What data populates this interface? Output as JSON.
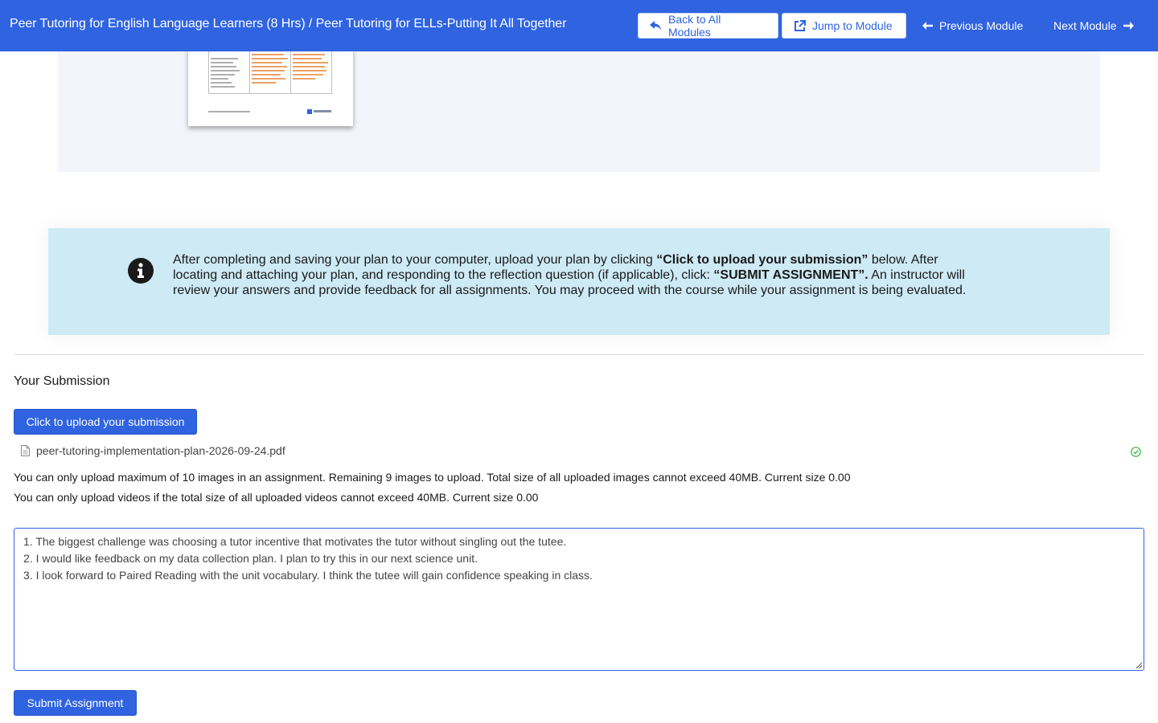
{
  "header": {
    "breadcrumb": "Peer Tutoring for English Language Learners (8 Hrs) / Peer Tutoring for ELLs-Putting It All Together",
    "back_label": "Back to All Modules",
    "jump_label": "Jump to Module",
    "prev_label": "Previous Module",
    "next_label": "Next Module"
  },
  "info": {
    "part1": "After completing and saving your plan to your computer, upload your plan by clicking ",
    "bold1": "“Click to upload your submission”",
    "part2": " below.  After locating and attaching your plan, and responding to the reflection question (if applicable), click: ",
    "bold2": "“SUBMIT ASSIGNMENT”.",
    "part3": "   An instructor will review your answers and provide feedback for all assignments.  You may proceed with the course while your assignment is being evaluated."
  },
  "submission": {
    "title": "Your Submission",
    "upload_label": "Click to upload your submission",
    "file_name": "peer-tutoring-implementation-plan-2026-09-24.pdf",
    "image_limit": "You can only upload maximum of 10 images in an assignment. Remaining 9 images to upload. Total size of all uploaded images cannot exceed 40MB. Current size 0.00",
    "video_limit": "You can only upload videos if the total size of all uploaded videos cannot exceed 40MB. Current size 0.00",
    "answers": [
      "1. The biggest challenge was choosing a tutor incentive that motivates the tutor without singling out the tutee.",
      "2. I would like feedback on my data collection plan. I plan to try this in our next science unit.",
      "3. I look forward to Paired Reading with the unit vocabulary. I think the tutee will gain confidence speaking in class."
    ],
    "submit_label": "Submit Assignment"
  },
  "colors": {
    "accent": "#2f63e0",
    "info_bg": "#cdeaf5",
    "success": "#3bb54a"
  },
  "icons": {
    "back": "reply-arrow-icon",
    "jump": "external-link-icon",
    "prev": "arrow-left-icon",
    "next": "arrow-right-icon",
    "info": "info-circle-icon",
    "file": "file-icon",
    "status": "check-circle-icon"
  }
}
